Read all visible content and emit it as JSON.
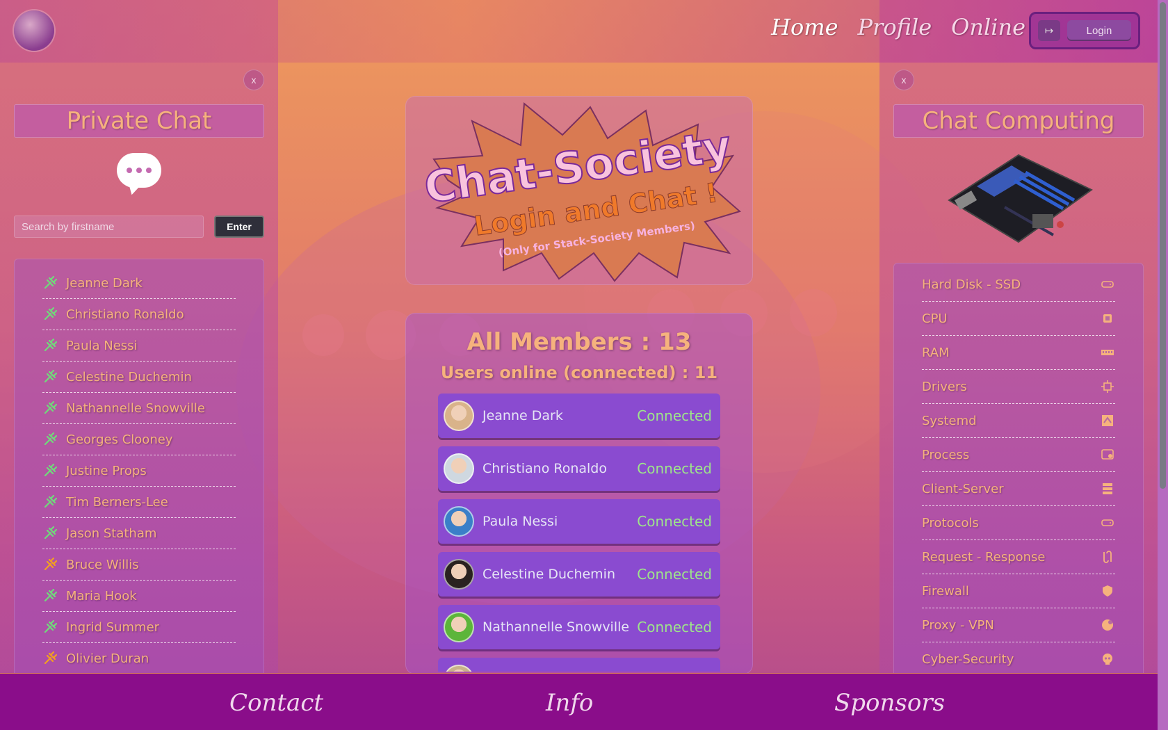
{
  "header": {
    "logo_alt": "koala",
    "nav": [
      {
        "label": "Home",
        "active": true
      },
      {
        "label": "Profile",
        "active": false
      },
      {
        "label": "Online",
        "active": false
      }
    ],
    "login_icon": "↦",
    "login_label": "Login"
  },
  "left_panel": {
    "close_label": "x",
    "title": "Private Chat",
    "search_placeholder": "Search by firstname",
    "enter_label": "Enter",
    "members": [
      {
        "name": "Jeanne Dark",
        "status": "online"
      },
      {
        "name": "Christiano Ronaldo",
        "status": "online"
      },
      {
        "name": "Paula Nessi",
        "status": "online"
      },
      {
        "name": "Celestine Duchemin",
        "status": "online"
      },
      {
        "name": "Nathannelle Snowville",
        "status": "online"
      },
      {
        "name": "Georges Clooney",
        "status": "online"
      },
      {
        "name": "Justine Props",
        "status": "online"
      },
      {
        "name": "Tim Berners-Lee",
        "status": "online"
      },
      {
        "name": "Jason Statham",
        "status": "online"
      },
      {
        "name": "Bruce Willis",
        "status": "offline"
      },
      {
        "name": "Maria Hook",
        "status": "online"
      },
      {
        "name": "Ingrid Summer",
        "status": "online"
      },
      {
        "name": "Olivier Duran",
        "status": "offline"
      }
    ]
  },
  "center": {
    "hero_title": "Chat-Society",
    "hero_subtitle": "Login and Chat !",
    "hero_note": "(Only for Stack-Society Members)",
    "all_members": "All Members : 13",
    "users_online": "Users online (connected) : 11",
    "connected": [
      {
        "name": "Jeanne Dark",
        "status": "Connected",
        "avatar_color": "#d9b38a"
      },
      {
        "name": "Christiano Ronaldo",
        "status": "Connected",
        "avatar_color": "#cfd8e0"
      },
      {
        "name": "Paula Nessi",
        "status": "Connected",
        "avatar_color": "#3a7fc8"
      },
      {
        "name": "Celestine Duchemin",
        "status": "Connected",
        "avatar_color": "#2a2220"
      },
      {
        "name": "Nathannelle Snowville",
        "status": "Connected",
        "avatar_color": "#5cb53a"
      },
      {
        "name": "",
        "status": "",
        "avatar_color": "#c9b28a"
      }
    ]
  },
  "right_panel": {
    "close_label": "x",
    "title": "Chat Computing",
    "items": [
      {
        "label": "Hard Disk - SSD",
        "icon": "hdd-icon"
      },
      {
        "label": "CPU",
        "icon": "cpu-icon"
      },
      {
        "label": "RAM",
        "icon": "ram-icon"
      },
      {
        "label": "Drivers",
        "icon": "driver-icon"
      },
      {
        "label": "Systemd",
        "icon": "systemd-icon"
      },
      {
        "label": "Process",
        "icon": "process-icon"
      },
      {
        "label": "Client-Server",
        "icon": "server-icon"
      },
      {
        "label": "Protocols",
        "icon": "hdd-icon"
      },
      {
        "label": "Request - Response",
        "icon": "request-icon"
      },
      {
        "label": "Firewall",
        "icon": "shield-icon"
      },
      {
        "label": "Proxy - VPN",
        "icon": "globe-icon"
      },
      {
        "label": "Cyber-Security",
        "icon": "skull-icon"
      }
    ]
  },
  "footer": {
    "links": [
      "Contact",
      "Info",
      "Sponsors"
    ]
  },
  "colors": {
    "accent_orange": "#f6b27d",
    "connected_green": "#9ee58a",
    "footer_purple": "#8a0d8a"
  }
}
